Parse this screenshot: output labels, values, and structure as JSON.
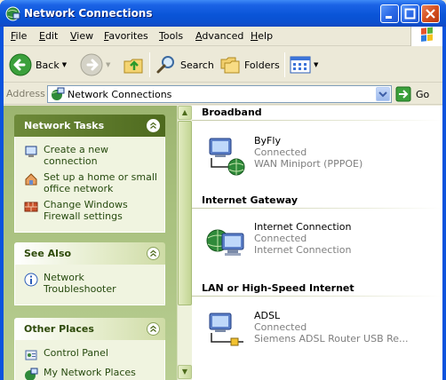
{
  "window": {
    "title": "Network Connections"
  },
  "menu": [
    "File",
    "Edit",
    "View",
    "Favorites",
    "Tools",
    "Advanced",
    "Help"
  ],
  "toolbar": {
    "back": "Back",
    "search": "Search",
    "folders": "Folders"
  },
  "address": {
    "label": "Address",
    "value": "Network Connections",
    "go": "Go"
  },
  "taskpane": {
    "network_tasks": {
      "title": "Network Tasks",
      "items": [
        "Create a new connection",
        "Set up a home or small office network",
        "Change Windows Firewall settings"
      ]
    },
    "see_also": {
      "title": "See Also",
      "items": [
        "Network Troubleshooter"
      ]
    },
    "other_places": {
      "title": "Other Places",
      "items": [
        "Control Panel",
        "My Network Places"
      ]
    }
  },
  "groups": [
    {
      "title": "Broadband",
      "items": [
        {
          "name": "ByFly",
          "status": "Connected",
          "device": "WAN Miniport (PPPOE)",
          "icon": "broadband-connection-icon"
        }
      ]
    },
    {
      "title": "Internet Gateway",
      "items": [
        {
          "name": "Internet Connection",
          "status": "Connected",
          "device": "Internet Connection",
          "icon": "internet-gateway-icon"
        }
      ]
    },
    {
      "title": "LAN or High-Speed Internet",
      "items": [
        {
          "name": "ADSL",
          "status": "Connected",
          "device": "Siemens ADSL Router USB Re...",
          "icon": "lan-connection-icon"
        }
      ]
    }
  ],
  "colors": {
    "titlebar": "#0A55D8",
    "taskpane": "#A9C17F",
    "link": "#264A0E"
  }
}
